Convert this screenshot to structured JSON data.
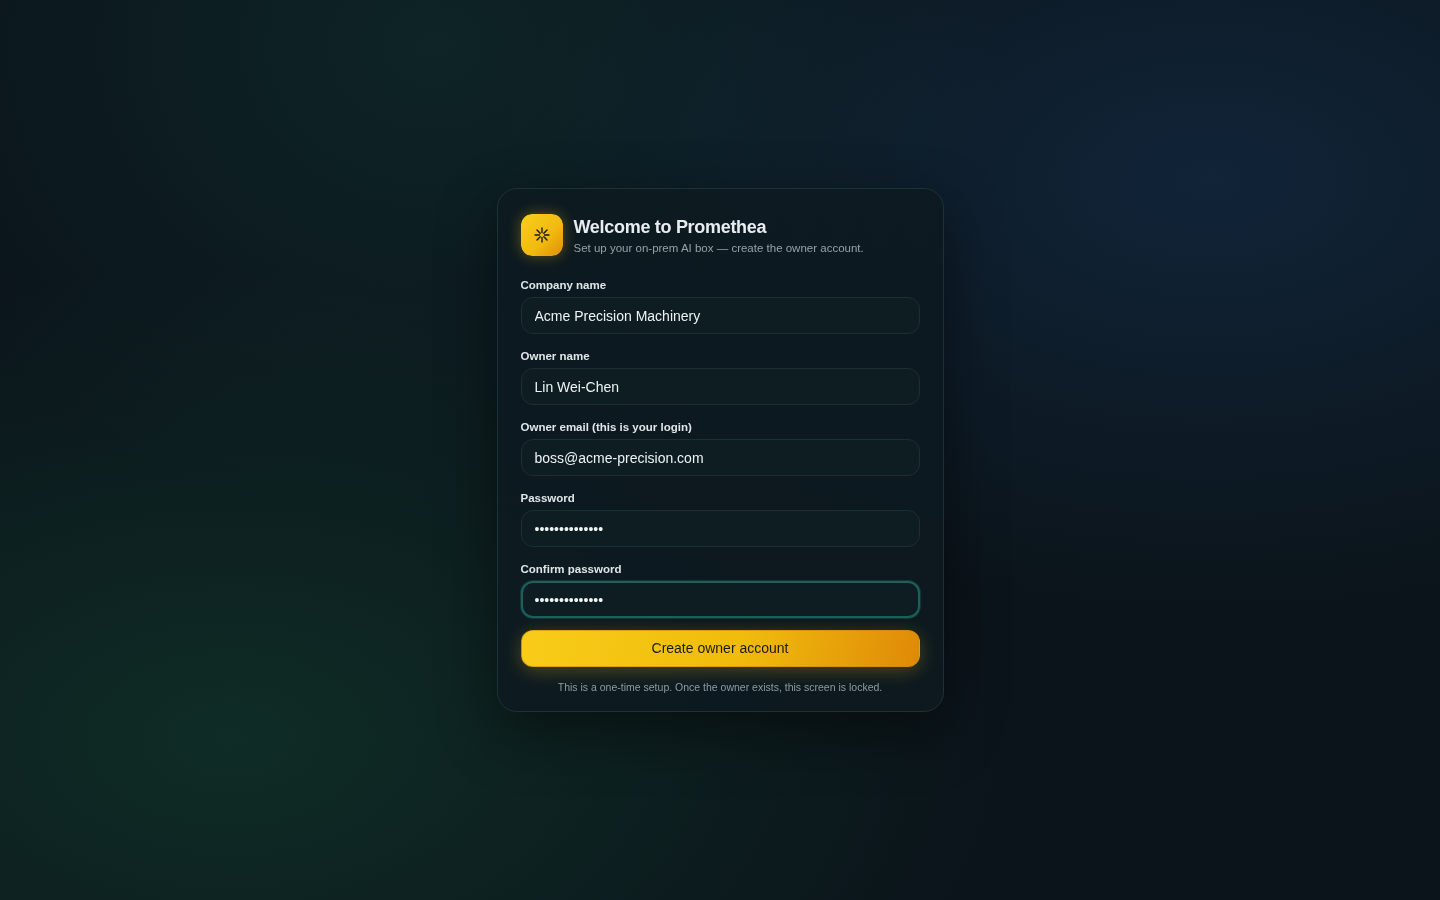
{
  "header": {
    "title": "Welcome to Promethea",
    "subtitle": "Set up your on-prem AI box — create the owner account."
  },
  "fields": [
    {
      "label": "Company name",
      "value": "Acme Precision Machinery",
      "focused": false
    },
    {
      "label": "Owner name",
      "value": "Lin Wei-Chen",
      "focused": false
    },
    {
      "label": "Owner email (this is your login)",
      "value": "boss@acme-precision.com",
      "focused": false
    },
    {
      "label": "Password",
      "value": "••••••••••••••",
      "focused": false
    },
    {
      "label": "Confirm password",
      "value": "••••••••••••••",
      "focused": true
    }
  ],
  "submit_button": {
    "label": "Create owner account"
  },
  "footnote": "This is a one-time setup. Once the owner exists, this screen is locked."
}
